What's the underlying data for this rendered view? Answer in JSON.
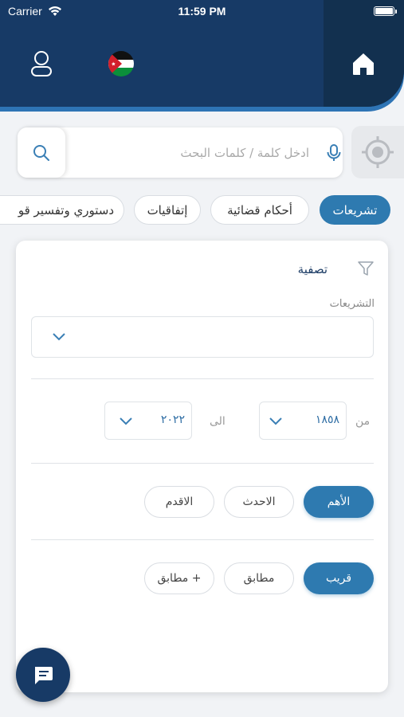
{
  "status_bar": {
    "carrier": "Carrier",
    "time": "11:59 PM"
  },
  "header": {
    "home_icon": "home-icon",
    "flag_icon": "jordan-flag-icon",
    "user_icon": "user-icon"
  },
  "search": {
    "placeholder": "ادخل كلمة / كلمات البحث",
    "value": ""
  },
  "tabs": [
    {
      "label": "تشريعات",
      "active": true
    },
    {
      "label": "أحكام قضائية",
      "active": false
    },
    {
      "label": "إتفاقيات",
      "active": false
    },
    {
      "label": "دستوري وتفسير قو",
      "active": false
    }
  ],
  "filter": {
    "title": "تصفية",
    "legislation_label": "التشريعات",
    "legislation_value": "",
    "from_label": "من",
    "from_year": "١٨٥٨",
    "to_label": "الى",
    "to_year": "٢٠٢٢",
    "sort_options": [
      {
        "label": "الأهم",
        "active": true
      },
      {
        "label": "الاحدث",
        "active": false
      },
      {
        "label": "الاقدم",
        "active": false
      }
    ],
    "match_options": [
      {
        "label": "قريب",
        "active": true
      },
      {
        "label": "مطابق",
        "active": false
      },
      {
        "label": "مطابق +",
        "active": false
      }
    ]
  },
  "colors": {
    "primary": "#173a66",
    "accent": "#2e7ab0"
  }
}
